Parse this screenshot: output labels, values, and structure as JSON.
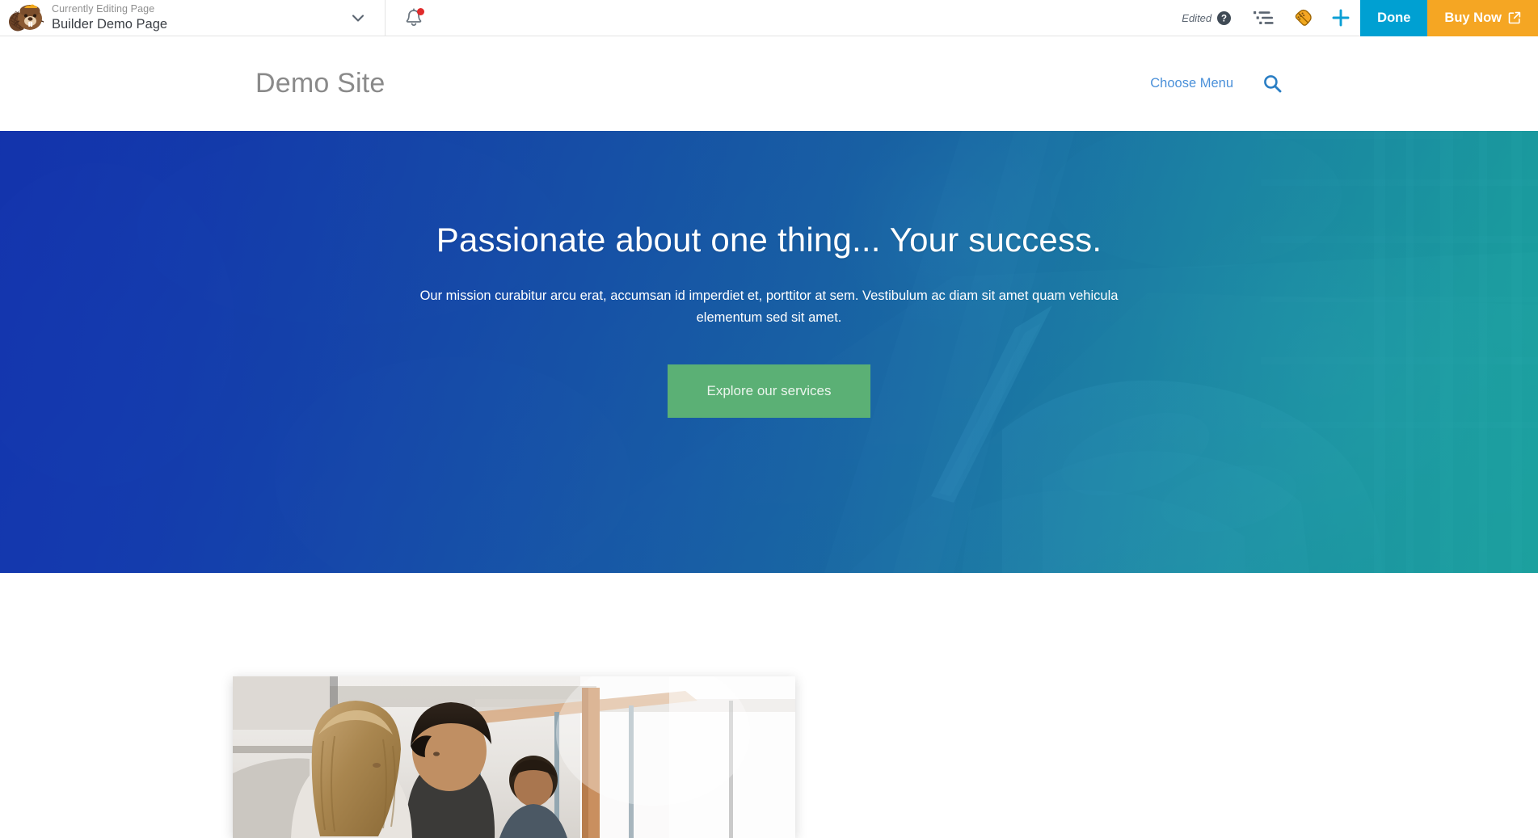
{
  "builder_bar": {
    "logo_icon": "beaver-builder-logo",
    "eyebrow": "Currently Editing Page",
    "page_name": "Builder Demo Page",
    "dropdown_icon": "chevron-down-icon",
    "bell_icon": "notification-bell-icon",
    "bell_has_alert": true,
    "edited_label": "Edited",
    "help_icon": "help-question-icon",
    "outline_icon": "outline-list-icon",
    "tools_icon": "builder-tools-trowel-icon",
    "add_icon": "plus-icon",
    "done_label": "Done",
    "buy_label": "Buy Now",
    "buy_external_icon": "external-link-icon",
    "colors": {
      "done_bg": "#00a0d2",
      "buy_bg": "#f5a623",
      "alert_dot": "#e02b2b",
      "accent_blue": "#0b9fd4"
    }
  },
  "site_header": {
    "site_title": "Demo Site",
    "choose_menu_label": "Choose Menu",
    "search_icon": "search-icon",
    "link_color": "#4a90d9",
    "title_color": "#8a8a8a"
  },
  "hero": {
    "headline": "Passionate about one thing... Your success.",
    "subtext": "Our mission curabitur arcu erat, accumsan id imperdiet et, porttitor at sem. Vestibulum ac diam sit amet quam vehicula elementum sed sit amet.",
    "cta_label": "Explore our services",
    "cta_color": "#5bb075",
    "gradient_from": "#1641c4",
    "gradient_to": "#24b3b0",
    "background_image": "people-using-tablet-and-stylus-photo"
  },
  "below_hero": {
    "image_alt": "office-team-collaborating-photo"
  }
}
